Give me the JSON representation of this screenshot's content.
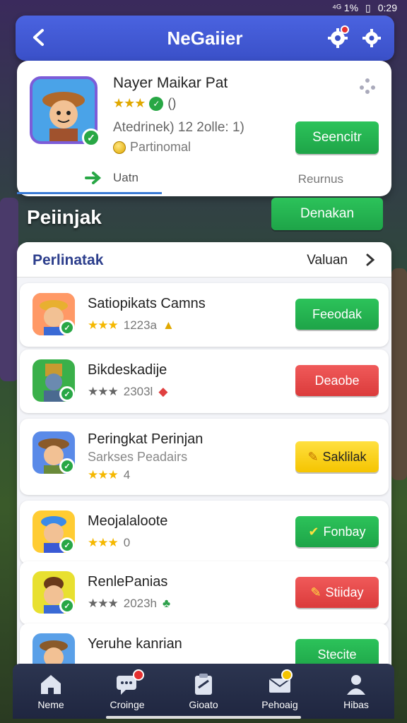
{
  "status_bar": {
    "time": "0:29",
    "signal": "⁴ᴳ 1%"
  },
  "app_bar": {
    "title": "NeGaiier"
  },
  "profile": {
    "name": "Nayer Maikar Pat",
    "rating_stars": "★★★",
    "rating_extra": "()",
    "stat": "Atedrinek) 12 2olle: 1)",
    "coins_label": "Partinomal",
    "action_label": "Seencitr",
    "tab_left": "Uatn",
    "tab_right": "Reurnus"
  },
  "section": {
    "title": "Peiinjak",
    "button_label": "Denakan"
  },
  "list": {
    "header_title": "Perlinatak",
    "header_right": "Valuan",
    "rows": [
      {
        "name": "Satiopikats Camns",
        "stars": "★★★",
        "count": "1223a",
        "button": "Feeodak",
        "button_color": "#1ea448"
      },
      {
        "name": "Bikdeskadije",
        "stars": "★★★",
        "count": "2303l",
        "button": "Deaobe",
        "button_color": "#db3b3b"
      },
      {
        "name": "Peringkat Perinjan",
        "subtitle": "Sarkses Peadairs",
        "stars": "★★★",
        "count": "4",
        "button": "Saklilak",
        "button_color": "#f5c400"
      },
      {
        "name": "Meojalaloote",
        "stars": "★★★",
        "count": "0",
        "button": "Fonbay",
        "button_color": "#1ea448"
      },
      {
        "name": "RenlePanias",
        "stars": "★★★",
        "count": "2023h",
        "button": "Stiiday",
        "button_color": "#db3b3b"
      },
      {
        "name": "Yeruhe kanrian",
        "stars": "",
        "count": "",
        "button": "Stecite",
        "button_color": "#1ea448"
      }
    ]
  },
  "bottom_nav": [
    {
      "label": "Neme",
      "icon": "home-icon"
    },
    {
      "label": "Croinge",
      "icon": "chat-icon"
    },
    {
      "label": "Gioato",
      "icon": "clipboard-icon"
    },
    {
      "label": "Pehoaig",
      "icon": "mail-icon"
    },
    {
      "label": "Hibas",
      "icon": "profile-icon"
    }
  ]
}
